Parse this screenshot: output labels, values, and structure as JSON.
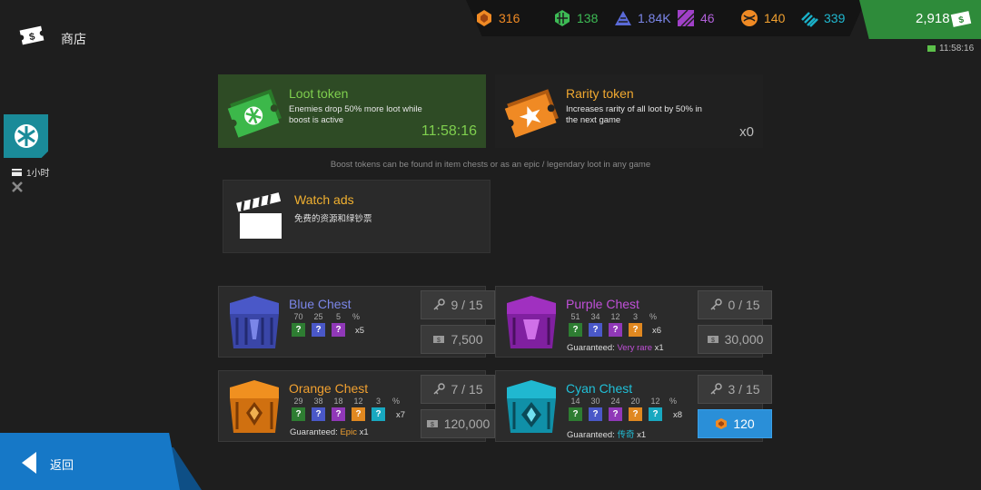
{
  "header": {
    "title": "商店"
  },
  "currencies": [
    {
      "name": "gem",
      "value": "316",
      "color": "#f08a24"
    },
    {
      "name": "green-shard",
      "value": "138",
      "color": "#3dbb55"
    },
    {
      "name": "blue-shard",
      "value": "1.84K",
      "color": "#5a6ad8"
    },
    {
      "name": "purple-shard",
      "value": "46",
      "color": "#a040c8"
    },
    {
      "name": "orange-shard",
      "value": "140",
      "color": "#f08a24"
    },
    {
      "name": "cyan-shard",
      "value": "339",
      "color": "#1ab0c8"
    }
  ],
  "premium": {
    "value": "2,918",
    "timer": "11:58:16"
  },
  "side": {
    "boost_duration": "1小时"
  },
  "tokens": {
    "loot": {
      "title": "Loot token",
      "desc": "Enemies drop 50% more loot while boost is active",
      "timer": "11:58:16"
    },
    "rarity": {
      "title": "Rarity token",
      "desc": "Increases rarity of all loot by 50% in the next game",
      "count": "x0"
    },
    "note": "Boost tokens can be found in item chests or as an epic / legendary loot in any game"
  },
  "watch_ads": {
    "title": "Watch ads",
    "desc": "免费的资源和绿钞票"
  },
  "chests": {
    "blue": {
      "name": "Blue Chest",
      "color": "#7b86e8",
      "odds": [
        "70",
        "25",
        "5"
      ],
      "mult": "x5",
      "keys": "9 / 15",
      "price": "7,500"
    },
    "purple": {
      "name": "Purple Chest",
      "color": "#c050d8",
      "odds": [
        "51",
        "34",
        "12",
        "3"
      ],
      "mult": "x6",
      "guar_label": "Guaranteed:",
      "guar_value": "Very rare",
      "guar_mult": "x1",
      "keys": "0 / 15",
      "price": "30,000"
    },
    "orange": {
      "name": "Orange Chest",
      "color": "#f0a030",
      "odds": [
        "29",
        "38",
        "18",
        "12",
        "3"
      ],
      "mult": "x7",
      "guar_label": "Guaranteed:",
      "guar_value": "Epic",
      "guar_mult": "x1",
      "keys": "7 / 15",
      "price": "120,000"
    },
    "cyan": {
      "name": "Cyan Chest",
      "color": "#20c0d8",
      "odds": [
        "14",
        "30",
        "24",
        "20",
        "12"
      ],
      "mult": "x8",
      "guar_label": "Guaranteed:",
      "guar_value": "传奇",
      "guar_mult": "x1",
      "keys": "3 / 15",
      "price": "120"
    }
  },
  "rarity_symbol": "?",
  "percent_symbol": "%",
  "back": {
    "label": "返回"
  }
}
